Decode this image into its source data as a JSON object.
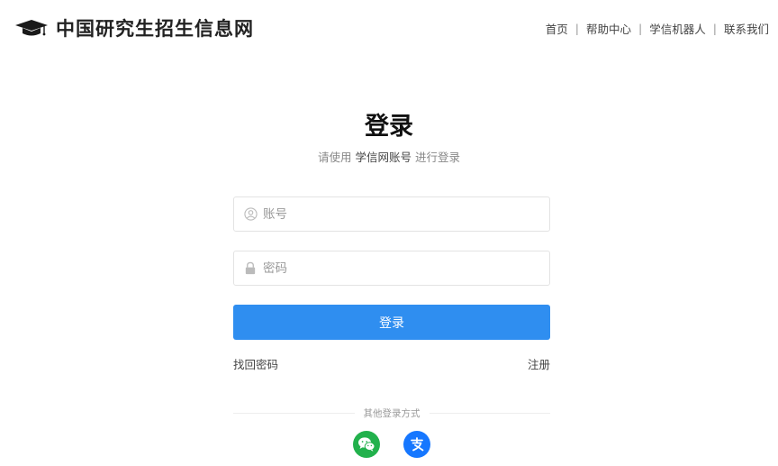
{
  "header": {
    "site_name": "中国研究生招生信息网",
    "nav": [
      {
        "label": "首页"
      },
      {
        "label": "帮助中心"
      },
      {
        "label": "学信机器人"
      },
      {
        "label": "联系我们"
      }
    ],
    "separator": "|"
  },
  "login": {
    "title": "登录",
    "subtitle_prefix": "请使用",
    "subtitle_account": "学信网账号",
    "subtitle_suffix": "进行登录",
    "account_placeholder": "账号",
    "account_value": "",
    "password_placeholder": "密码",
    "password_value": "",
    "submit_label": "登录",
    "forgot_label": "找回密码",
    "register_label": "注册",
    "other_methods_label": "其他登录方式"
  },
  "social": [
    {
      "name": "wechat",
      "icon": "wechat-icon",
      "color": "#22b14c"
    },
    {
      "name": "alipay",
      "icon": "alipay-icon",
      "color": "#1677ff"
    }
  ],
  "colors": {
    "primary": "#2f8ef0",
    "text": "#333333",
    "muted": "#999999"
  }
}
